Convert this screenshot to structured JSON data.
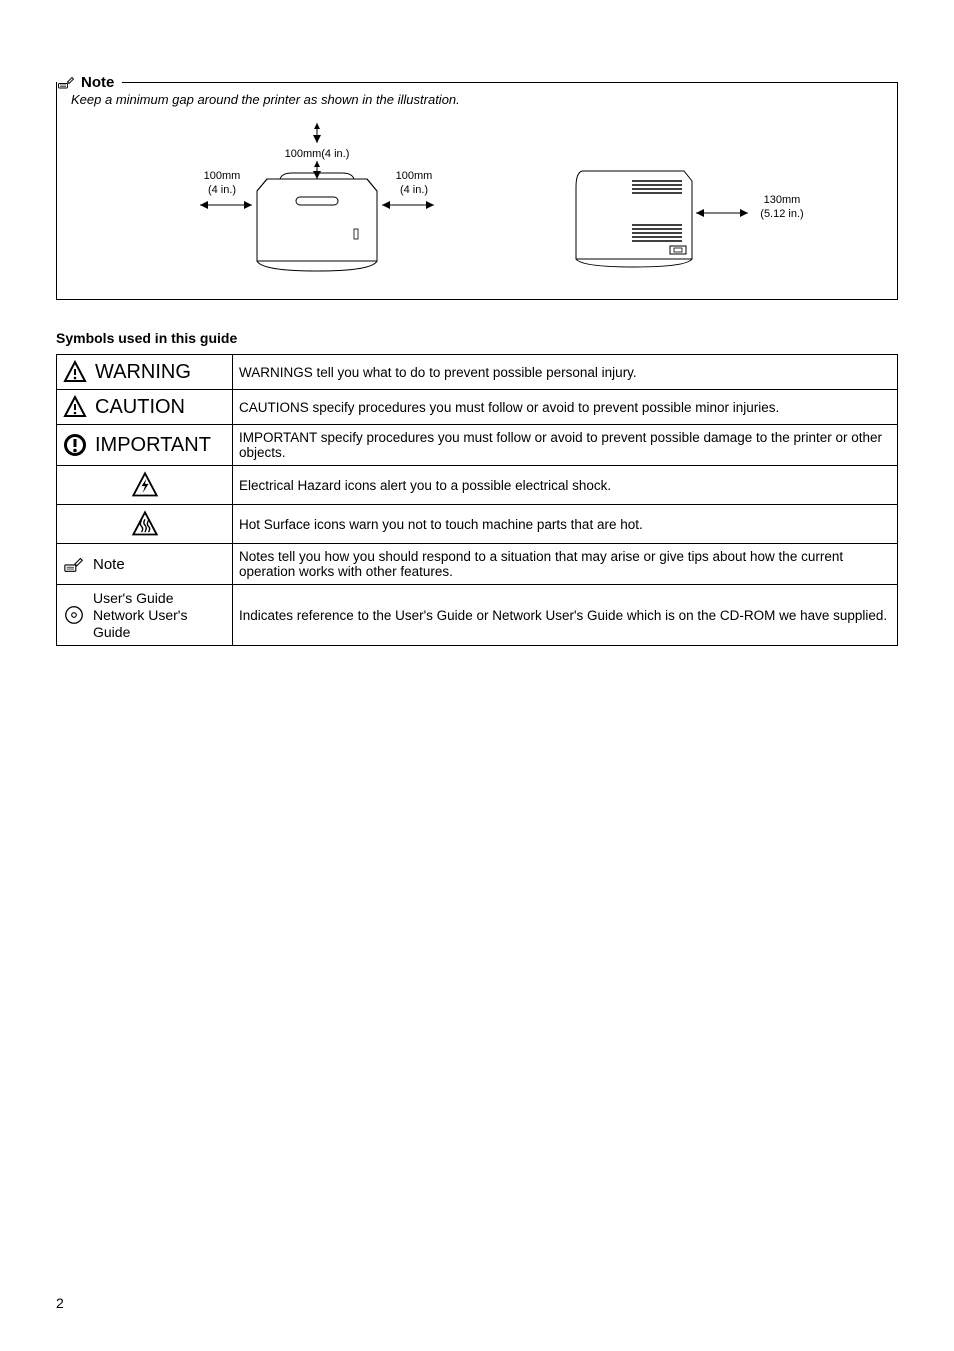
{
  "note": {
    "title": "Note",
    "text": "Keep a minimum gap around the printer as shown in the illustration.",
    "dims": {
      "top": "100mm(4 in.)",
      "left_mm": "100mm",
      "left_in": "(4 in.)",
      "right_mm": "100mm",
      "right_in": "(4 in.)",
      "back_mm": "130mm",
      "back_in": "(5.12 in.)"
    }
  },
  "symbolsHeading": "Symbols used in this guide",
  "rows": {
    "warning": {
      "label": "WARNING",
      "desc": "WARNINGS tell you what to do to prevent possible personal injury."
    },
    "caution": {
      "label": "CAUTION",
      "desc": "CAUTIONS specify procedures you must follow or avoid to prevent possible minor injuries."
    },
    "important": {
      "label": "IMPORTANT",
      "desc": "IMPORTANT specify procedures you must follow or avoid to prevent possible damage to the printer or other objects."
    },
    "electrical": {
      "desc": "Electrical Hazard icons alert you to a possible electrical shock."
    },
    "hot": {
      "desc": "Hot Surface icons warn you not to touch machine parts that are hot."
    },
    "note": {
      "label": "Note",
      "desc": "Notes tell you how you should respond to a situation that may arise or give tips about how the current operation works with other features."
    },
    "guide": {
      "label1": "User's Guide",
      "label2": "Network User's",
      "label3": "Guide",
      "desc": "Indicates reference to the User's Guide or Network User's Guide which is on the CD-ROM we have supplied."
    }
  },
  "pageNumber": "2"
}
